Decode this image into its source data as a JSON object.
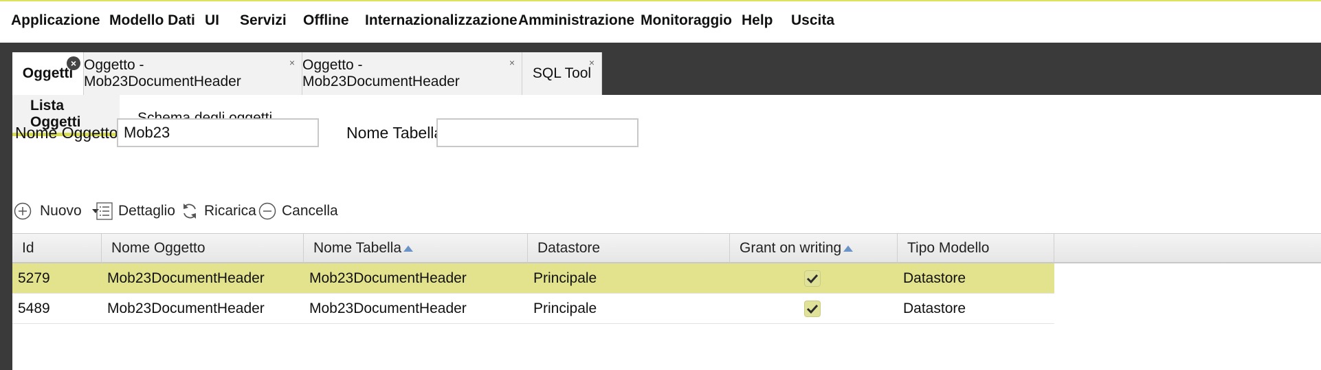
{
  "menu": [
    "Applicazione",
    "Modello Dati",
    "UI",
    "Servizi",
    "Offline",
    "Internazionalizzazione",
    "Amministrazione",
    "Monitoraggio",
    "Help",
    "Uscita"
  ],
  "tabs": [
    {
      "label": "Oggetti",
      "close": "×"
    },
    {
      "label": "Oggetto - Mob23DocumentHeader",
      "close": "×"
    },
    {
      "label": "Oggetto - Mob23DocumentHeader",
      "close": "×"
    },
    {
      "label": "SQL Tool",
      "close": "×"
    }
  ],
  "subtabs": [
    "Lista Oggetti",
    "Schema degli oggetti"
  ],
  "filters": {
    "object_name_label": "Nome Oggetto",
    "object_name_value": "Mob23",
    "table_name_label": "Nome Tabella",
    "table_name_value": ""
  },
  "toolbar": {
    "new_label": "Nuovo",
    "detail_label": "Dettaglio",
    "reload_label": "Ricarica",
    "delete_label": "Cancella"
  },
  "grid": {
    "columns": [
      "Id",
      "Nome Oggetto",
      "Nome Tabella",
      "Datastore",
      "Grant on writing",
      "Tipo Modello"
    ],
    "rows": [
      {
        "id": "5279",
        "name": "Mob23DocumentHeader",
        "table": "Mob23DocumentHeader",
        "datastore": "Principale",
        "grant": true,
        "type": "Datastore"
      },
      {
        "id": "5489",
        "name": "Mob23DocumentHeader",
        "table": "Mob23DocumentHeader",
        "datastore": "Principale",
        "grant": true,
        "type": "Datastore"
      }
    ]
  },
  "colors": {
    "accent": "#d7dd55",
    "selected_row": "#e3e38d",
    "workspace": "#3a3a3a",
    "sort_arrow": "#6b93c8"
  }
}
